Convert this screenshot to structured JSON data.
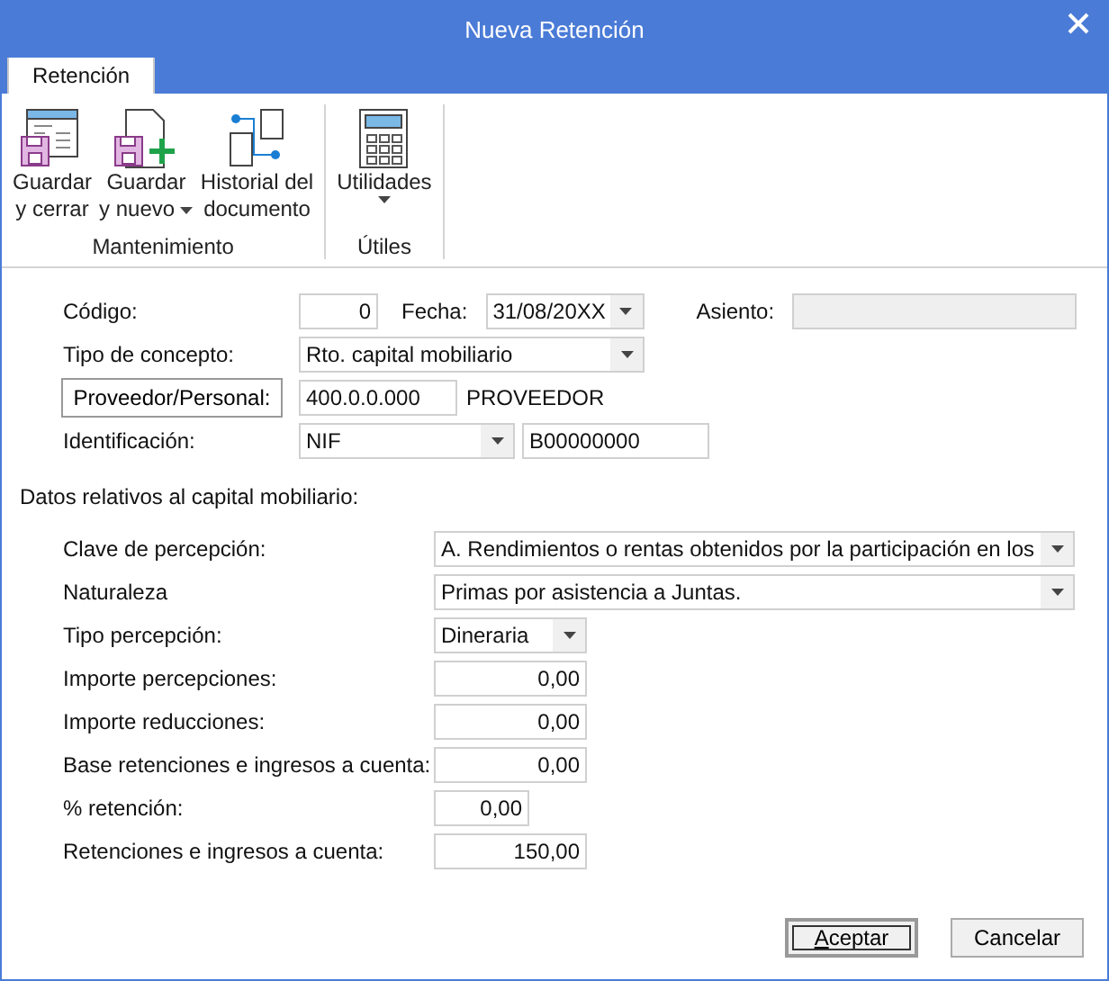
{
  "window": {
    "title": "Nueva Retención"
  },
  "tabs": [
    {
      "label": "Retención",
      "selected": true
    }
  ],
  "ribbon": [
    {
      "label": "Mantenimiento",
      "buttons": [
        {
          "lines": [
            "Guardar",
            "y cerrar"
          ],
          "menu": false
        },
        {
          "lines": [
            "Guardar",
            "y nuevo"
          ],
          "menu": true
        },
        {
          "lines": [
            "Historial del",
            "documento"
          ],
          "menu": false
        }
      ]
    },
    {
      "label": "Útiles",
      "buttons": [
        {
          "lines": [
            "Utilidades"
          ],
          "menu": true
        }
      ]
    }
  ],
  "header": {
    "codigo": {
      "label": "Código:",
      "value": "0"
    },
    "fecha": {
      "label": "Fecha:",
      "value": "31/08/20XX"
    },
    "asiento": {
      "label": "Asiento:",
      "disabled": true
    },
    "tipo_concepto": {
      "label": "Tipo de concepto:",
      "value": "Rto. capital mobiliario"
    },
    "proveedor": {
      "button": "Proveedor/Personal:",
      "value": "400.0.0.000",
      "name": "PROVEEDOR"
    },
    "identificacion": {
      "label": "Identificación:",
      "type": "NIF",
      "value": "B00000000"
    }
  },
  "capital": {
    "title": "Datos relativos al capital mobiliario:",
    "rows": [
      {
        "label": "Clave de percepción:",
        "kind": "dropdown",
        "value": "A. Rendimientos o rentas obtenidos por la participación en los"
      },
      {
        "label": "Naturaleza",
        "kind": "dropdown",
        "value": "Primas por asistencia a Juntas."
      },
      {
        "label": "Tipo percepción:",
        "kind": "dropdown",
        "value": "Dineraria"
      },
      {
        "label": "Importe percepciones:",
        "kind": "number",
        "value": "0,00"
      },
      {
        "label": "Importe reducciones:",
        "kind": "number",
        "value": "0,00"
      },
      {
        "label": "Base retenciones e ingresos a cuenta:",
        "kind": "number",
        "value": "0,00"
      },
      {
        "label": "% retención:",
        "kind": "number",
        "value": "0,00"
      },
      {
        "label": "Retenciones e ingresos a cuenta:",
        "kind": "number",
        "value": "150,00"
      }
    ]
  },
  "buttons": [
    {
      "label": "Aceptar",
      "default": true
    },
    {
      "label": "Cancelar",
      "default": false
    }
  ]
}
